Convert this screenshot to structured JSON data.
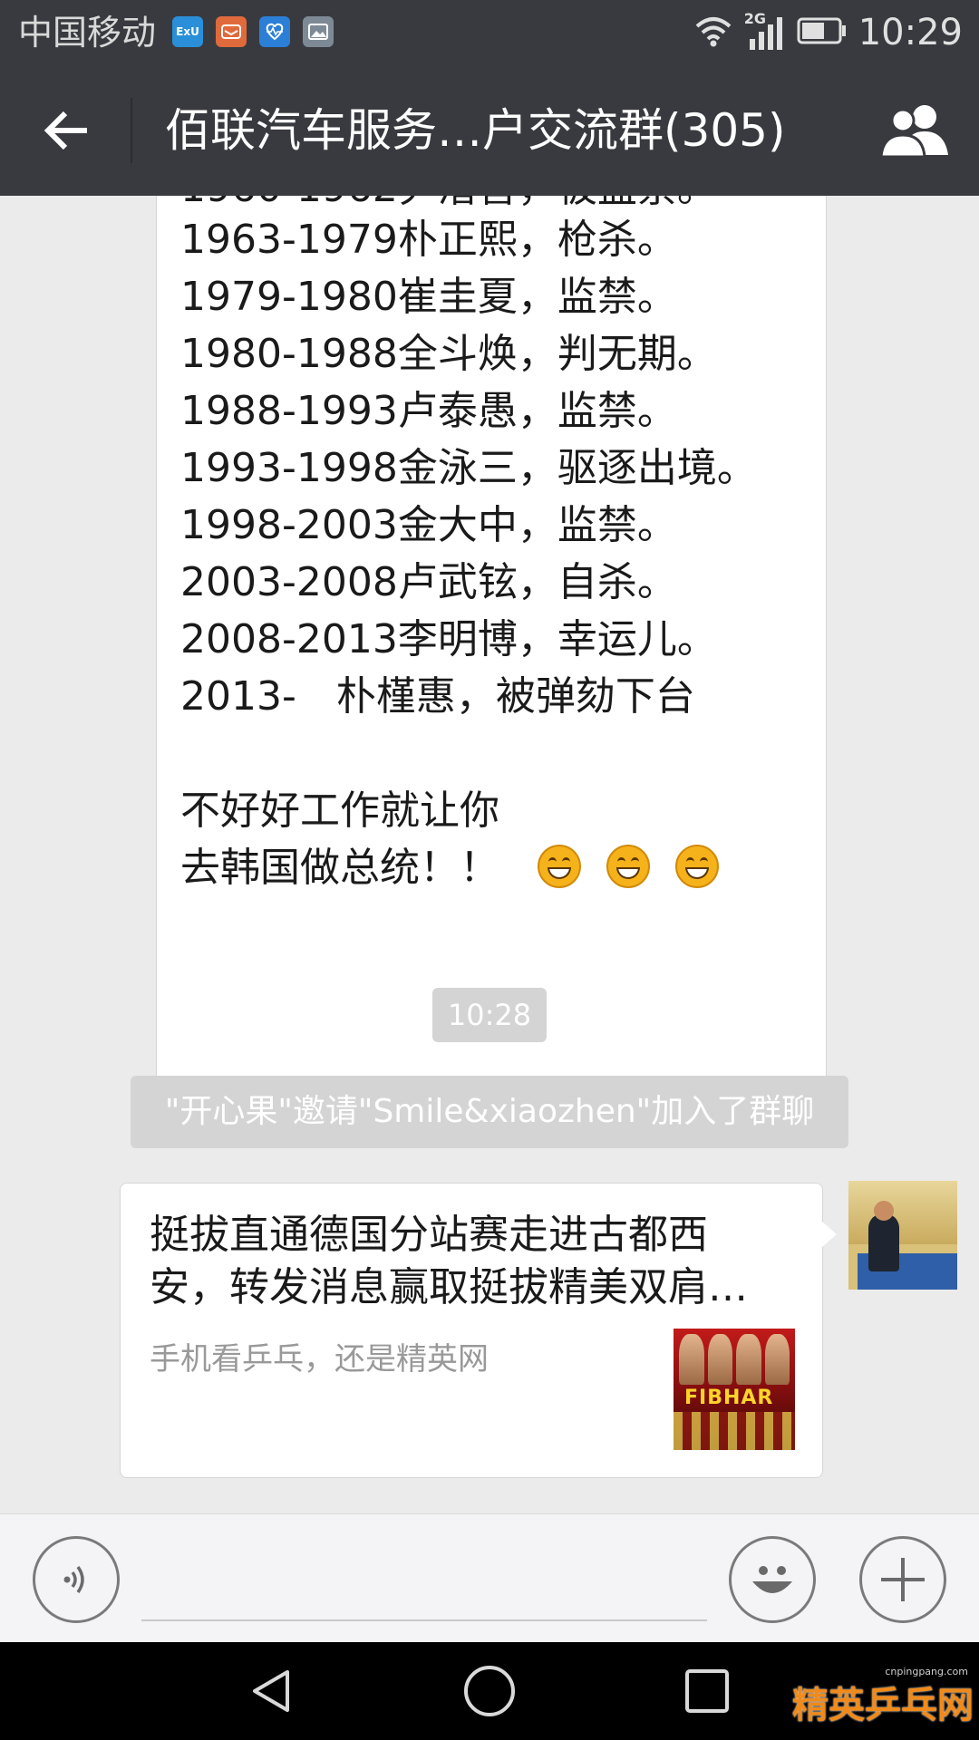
{
  "status_bar": {
    "carrier": "中国移动",
    "notification_icons": [
      "xiaomi-app-icon",
      "mail-app-icon",
      "health-app-icon",
      "gallery-app-icon"
    ],
    "network_label": "2G",
    "time": "10:29"
  },
  "header": {
    "title": "佰联汽车服务…户交流群(305)",
    "back_icon": "arrow-left-icon",
    "members_icon": "group-members-icon"
  },
  "messages": {
    "text_lines": [
      "1963-1979朴正熙，枪杀。",
      "1979-1980崔圭夏，监禁。",
      "1980-1988全斗焕，判无期。",
      "1988-1993卢泰愚，监禁。",
      "1993-1998金泳三，驱逐出境。",
      "1998-2003金大中，监禁。",
      "2003-2008卢武铉，自杀。",
      "2008-2013李明博，幸运儿。",
      "2013-　朴槿惠，被弹劾下台",
      "",
      "不好好工作就让你",
      "去韩国做总统！！"
    ],
    "emoji_count": 3,
    "timestamp": "10:28",
    "system_notice": "\"开心果\"邀请\"Smile&xiaozhen\"加入了群聊",
    "link_card": {
      "title_line1": "挺拔直通德国分站赛走进古都西",
      "title_line2": "安，转发消息赢取挺拔精美双肩…",
      "description": "手机看乒乓，还是精英网",
      "thumbnail_brand": "FIBHAR"
    }
  },
  "input_bar": {
    "voice_icon": "voice-input-icon",
    "emoji_icon": "emoji-smile-icon",
    "plus_icon": "plus-icon"
  },
  "nav_bar": {
    "back_icon": "nav-back-icon",
    "home_icon": "nav-home-icon",
    "recents_icon": "nav-recents-icon"
  },
  "watermark": {
    "url": "cnpingpang.com",
    "text": "精英乒乓网"
  },
  "colors": {
    "header_bg": "#393a3f",
    "chat_bg": "#ebebeb",
    "bubble_bg": "#ffffff",
    "system_chip_bg": "#d4d4d4"
  }
}
